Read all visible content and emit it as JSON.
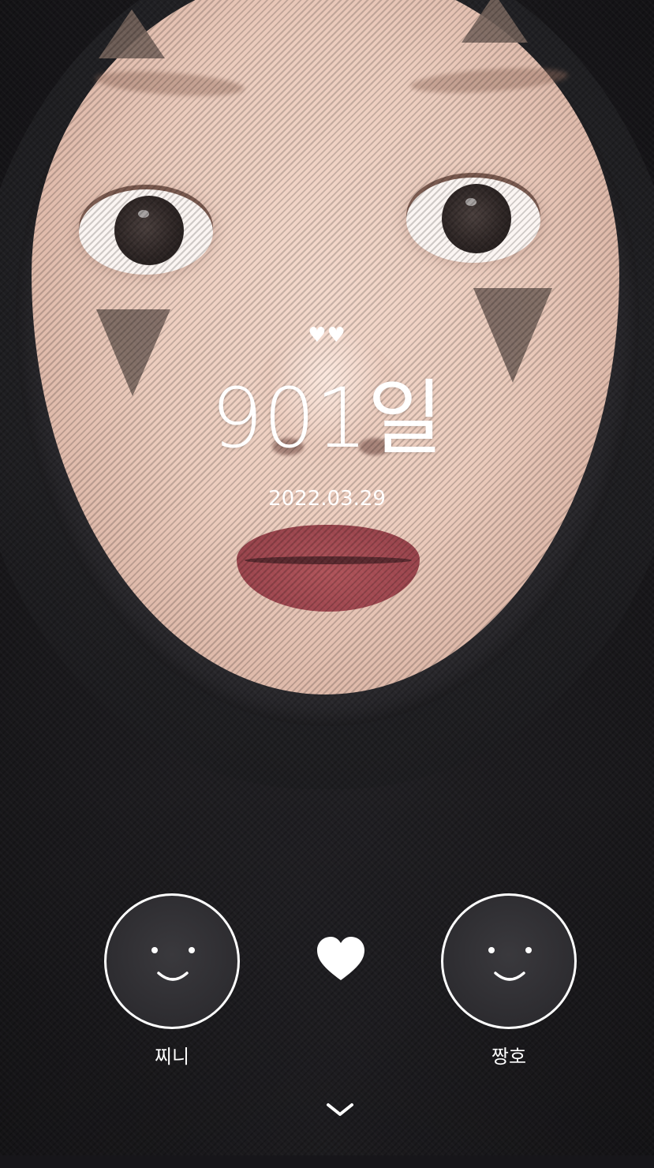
{
  "counter": {
    "hearts": "♥♥",
    "days": "901일",
    "start_date": "2022.03.29"
  },
  "couple": {
    "left_name": "찌니",
    "right_name": "짱호",
    "left_avatar_icon": "smiley-face-icon",
    "right_avatar_icon": "smiley-face-icon",
    "center_icon": "heart-icon"
  },
  "navigation": {
    "scroll_icon": "chevron-down-icon"
  },
  "colors": {
    "text": "#ffffff",
    "background": "#1c1b1e"
  }
}
